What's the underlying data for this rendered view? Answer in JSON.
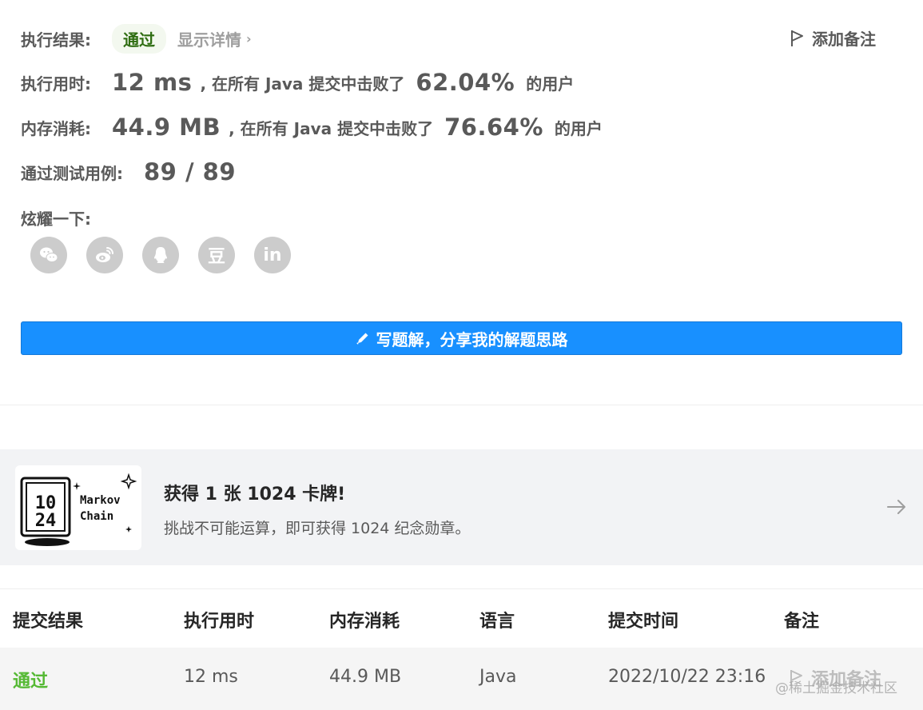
{
  "result": {
    "label": "执行结果:",
    "status": "通过",
    "details_link": "显示详情",
    "add_note": "添加备注"
  },
  "runtime": {
    "label": "执行用时:",
    "value": "12 ms",
    "text_before": ", 在所有 Java 提交中击败了",
    "percent": "62.04%",
    "text_after": "的用户"
  },
  "memory": {
    "label": "内存消耗:",
    "value": "44.9 MB",
    "text_before": ", 在所有 Java 提交中击败了",
    "percent": "76.64%",
    "text_after": "的用户"
  },
  "testcases": {
    "label": "通过测试用例:",
    "value": "89 / 89"
  },
  "share": {
    "label": "炫耀一下:",
    "buttons": [
      "wechat-icon",
      "weibo-icon",
      "qq-icon",
      "douban-icon",
      "linkedin-icon"
    ],
    "douban_glyph": "豆",
    "linkedin_glyph": "in"
  },
  "write_solution": {
    "label": "写题解，分享我的解题思路",
    "color": "#1890ff"
  },
  "banner": {
    "card_text_line1": "Markov",
    "card_text_line2": "Chain",
    "title": "获得 1 张 1024 卡牌!",
    "subtitle": "挑战不可能运算，即可获得 1024 纪念勋章。"
  },
  "table": {
    "headers": [
      "提交结果",
      "执行用时",
      "内存消耗",
      "语言",
      "提交时间",
      "备注"
    ],
    "row": {
      "status": "通过",
      "runtime": "12 ms",
      "memory": "44.9 MB",
      "language": "Java",
      "time": "2022/10/22 23:16",
      "note": "添加备注"
    },
    "watermark": "@稀土掘金技术社区"
  }
}
